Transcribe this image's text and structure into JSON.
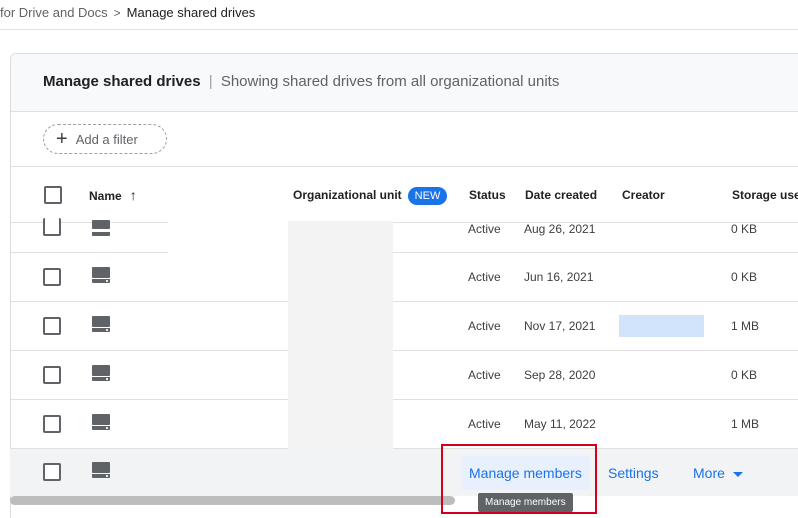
{
  "breadcrumb": {
    "previous": "for Drive and Docs",
    "separator": ">",
    "current": "Manage shared drives"
  },
  "header": {
    "title": "Manage shared drives",
    "divider": "|",
    "subtitle": "Showing shared drives from all organizational units"
  },
  "filter": {
    "plus": "+",
    "label": "Add a filter"
  },
  "columns": {
    "name": "Name",
    "sort_arrow": "↑",
    "org_unit": "Organizational unit",
    "new_badge": "NEW",
    "status": "Status",
    "date_created": "Date created",
    "creator": "Creator",
    "storage": "Storage used"
  },
  "rows": [
    {
      "status": "Active",
      "date": "Aug 26, 2021",
      "storage": "0 KB"
    },
    {
      "status": "Active",
      "date": "Jun 16, 2021",
      "storage": "0 KB"
    },
    {
      "status": "Active",
      "date": "Nov 17, 2021",
      "storage": "1 MB"
    },
    {
      "status": "Active",
      "date": "Sep 28, 2020",
      "storage": "0 KB"
    },
    {
      "status": "Active",
      "date": "May 11, 2022",
      "storage": "1 MB"
    }
  ],
  "hover_row_actions": {
    "manage_members": "Manage members",
    "settings": "Settings",
    "more": "More"
  },
  "tooltip": "Manage members",
  "colors": {
    "accent": "#1a73e8",
    "highlight": "#d0021b",
    "creator_placeholder": "#d2e3fc"
  }
}
